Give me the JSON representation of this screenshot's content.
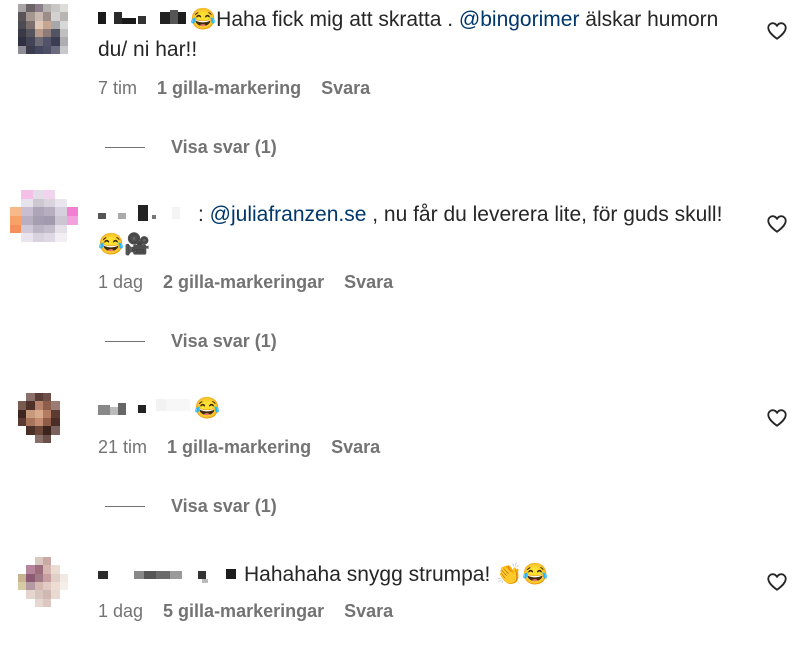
{
  "comments": [
    {
      "text_before": "😂Haha fick mig att skratta . ",
      "mention": "@bingorimer",
      "text_after": " älskar humorn du/ ni har!!",
      "time": "7 tim",
      "likes": "1 gilla-markering",
      "reply": "Svara",
      "view_replies": "Visa svar (1)"
    },
    {
      "text_before": ": ",
      "mention": "@juliafranzen.se",
      "text_after": " , nu får du leverera lite, för guds skull! 😂🎥",
      "time": "1 dag",
      "likes": "2 gilla-markeringar",
      "reply": "Svara",
      "view_replies": "Visa svar (1)"
    },
    {
      "text_before": "😂",
      "mention": "",
      "text_after": "",
      "time": "21 tim",
      "likes": "1 gilla-markering",
      "reply": "Svara",
      "view_replies": "Visa svar (1)"
    },
    {
      "text_before": "Hahahaha snygg strumpa! 👏😂",
      "mention": "",
      "text_after": "",
      "time": "1 dag",
      "likes": "5 gilla-markeringar",
      "reply": "Svara"
    }
  ],
  "icons": {
    "like": "heart-icon",
    "avatar": "blurred-avatar"
  },
  "colors": {
    "mention": "#00376b",
    "meta": "#737373",
    "text": "#262626"
  }
}
